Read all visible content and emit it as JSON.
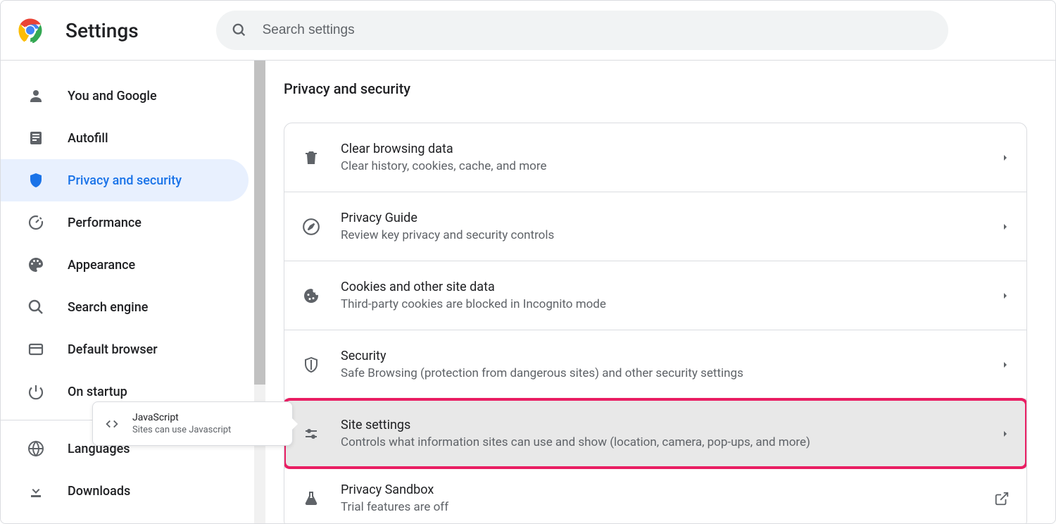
{
  "header": {
    "title": "Settings",
    "search_placeholder": "Search settings"
  },
  "sidebar": {
    "items": [
      {
        "label": "You and Google",
        "icon": "person-icon"
      },
      {
        "label": "Autofill",
        "icon": "autofill-icon"
      },
      {
        "label": "Privacy and security",
        "icon": "shield-icon",
        "active": true
      },
      {
        "label": "Performance",
        "icon": "speedometer-icon"
      },
      {
        "label": "Appearance",
        "icon": "palette-icon"
      },
      {
        "label": "Search engine",
        "icon": "search-icon"
      },
      {
        "label": "Default browser",
        "icon": "browser-icon"
      },
      {
        "label": "On startup",
        "icon": "power-icon"
      }
    ],
    "items_lower": [
      {
        "label": "Languages",
        "icon": "globe-icon"
      },
      {
        "label": "Downloads",
        "icon": "download-icon"
      }
    ]
  },
  "main": {
    "section_title": "Privacy and security",
    "cards": [
      {
        "title": "Clear browsing data",
        "sub": "Clear history, cookies, cache, and more",
        "icon": "trash-icon"
      },
      {
        "title": "Privacy Guide",
        "sub": "Review key privacy and security controls",
        "icon": "compass-icon"
      },
      {
        "title": "Cookies and other site data",
        "sub": "Third-party cookies are blocked in Incognito mode",
        "icon": "cookie-icon"
      },
      {
        "title": "Security",
        "sub": "Safe Browsing (protection from dangerous sites) and other security settings",
        "icon": "shield-outline-icon"
      },
      {
        "title": "Site settings",
        "sub": "Controls what information sites can use and show (location, camera, pop-ups, and more)",
        "icon": "sliders-icon",
        "highlighted": true,
        "boxed": true
      },
      {
        "title": "Privacy Sandbox",
        "sub": "Trial features are off",
        "icon": "flask-icon",
        "external": true
      }
    ]
  },
  "tooltip": {
    "title": "JavaScript",
    "sub": "Sites can use Javascript"
  }
}
